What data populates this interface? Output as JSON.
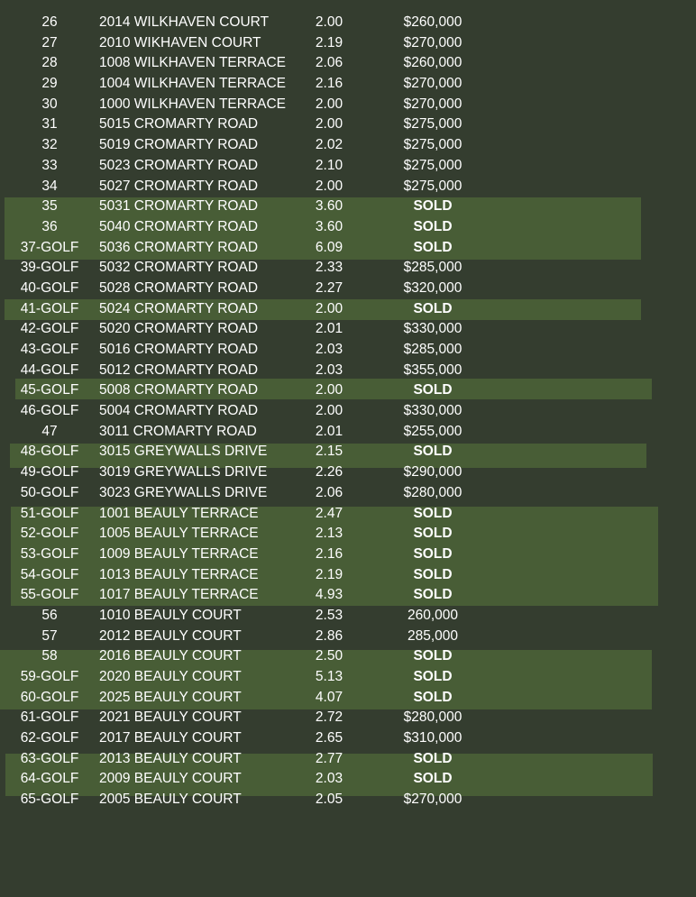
{
  "lots": [
    {
      "lot": "26",
      "address": "2014 WILKHAVEN COURT",
      "acres": "2.00",
      "price": "$260,000"
    },
    {
      "lot": "27",
      "address": "2010 WIKHAVEN COURT",
      "acres": "2.19",
      "price": "$270,000"
    },
    {
      "lot": "28",
      "address": "1008 WILKHAVEN TERRACE",
      "acres": "2.06",
      "price": "$260,000"
    },
    {
      "lot": "29",
      "address": "1004 WILKHAVEN TERRACE",
      "acres": "2.16",
      "price": "$270,000"
    },
    {
      "lot": "30",
      "address": "1000 WILKHAVEN TERRACE",
      "acres": "2.00",
      "price": "$270,000"
    },
    {
      "lot": "31",
      "address": "5015 CROMARTY ROAD",
      "acres": "2.00",
      "price": "$275,000"
    },
    {
      "lot": "32",
      "address": "5019 CROMARTY ROAD",
      "acres": "2.02",
      "price": "$275,000"
    },
    {
      "lot": "33",
      "address": "5023 CROMARTY ROAD",
      "acres": "2.10",
      "price": "$275,000"
    },
    {
      "lot": "34",
      "address": "5027 CROMARTY ROAD",
      "acres": "2.00",
      "price": "$275,000"
    },
    {
      "lot": "35",
      "address": "5031 CROMARTY ROAD",
      "acres": "3.60",
      "price": "SOLD"
    },
    {
      "lot": "36",
      "address": "5040 CROMARTY ROAD",
      "acres": "3.60",
      "price": "SOLD"
    },
    {
      "lot": "37-GOLF",
      "address": "5036 CROMARTY ROAD",
      "acres": "6.09",
      "price": "SOLD"
    },
    {
      "lot": "39-GOLF",
      "address": "5032 CROMARTY ROAD",
      "acres": "2.33",
      "price": "$285,000"
    },
    {
      "lot": "40-GOLF",
      "address": "5028 CROMARTY ROAD",
      "acres": "2.27",
      "price": "$320,000"
    },
    {
      "lot": "41-GOLF",
      "address": "5024 CROMARTY ROAD",
      "acres": "2.00",
      "price": "SOLD"
    },
    {
      "lot": "42-GOLF",
      "address": "5020 CROMARTY ROAD",
      "acres": "2.01",
      "price": "$330,000"
    },
    {
      "lot": "43-GOLF",
      "address": "5016 CROMARTY ROAD",
      "acres": "2.03",
      "price": "$285,000"
    },
    {
      "lot": "44-GOLF",
      "address": "5012 CROMARTY ROAD",
      "acres": "2.03",
      "price": "$355,000"
    },
    {
      "lot": "45-GOLF",
      "address": "5008 CROMARTY ROAD",
      "acres": "2.00",
      "price": "SOLD"
    },
    {
      "lot": "46-GOLF",
      "address": "5004 CROMARTY ROAD",
      "acres": "2.00",
      "price": "$330,000"
    },
    {
      "lot": "47",
      "address": "3011 CROMARTY ROAD",
      "acres": "2.01",
      "price": "$255,000"
    },
    {
      "lot": "48-GOLF",
      "address": "3015 GREYWALLS DRIVE",
      "acres": "2.15",
      "price": "SOLD"
    },
    {
      "lot": "49-GOLF",
      "address": "3019 GREYWALLS DRIVE",
      "acres": "2.26",
      "price": "$290,000"
    },
    {
      "lot": "50-GOLF",
      "address": "3023 GREYWALLS DRIVE",
      "acres": "2.06",
      "price": "$280,000"
    },
    {
      "lot": "51-GOLF",
      "address": "1001 BEAULY TERRACE",
      "acres": "2.47",
      "price": "SOLD"
    },
    {
      "lot": "52-GOLF",
      "address": "1005 BEAULY TERRACE",
      "acres": "2.13",
      "price": "SOLD"
    },
    {
      "lot": "53-GOLF",
      "address": "1009 BEAULY TERRACE",
      "acres": "2.16",
      "price": "SOLD"
    },
    {
      "lot": "54-GOLF",
      "address": "1013 BEAULY TERRACE",
      "acres": "2.19",
      "price": "SOLD"
    },
    {
      "lot": "55-GOLF",
      "address": "1017 BEAULY TERRACE",
      "acres": "4.93",
      "price": "SOLD"
    },
    {
      "lot": "56",
      "address": "1010 BEAULY COURT",
      "acres": "2.53",
      "price": "260,000"
    },
    {
      "lot": "57",
      "address": "2012 BEAULY COURT",
      "acres": "2.86",
      "price": "285,000"
    },
    {
      "lot": "58",
      "address": "2016 BEAULY COURT",
      "acres": "2.50",
      "price": "SOLD"
    },
    {
      "lot": "59-GOLF",
      "address": "2020 BEAULY COURT",
      "acres": "5.13",
      "price": "SOLD"
    },
    {
      "lot": "60-GOLF",
      "address": "2025 BEAULY COURT",
      "acres": "4.07",
      "price": "SOLD"
    },
    {
      "lot": "61-GOLF",
      "address": "2021 BEAULY COURT",
      "acres": "2.72",
      "price": "$280,000"
    },
    {
      "lot": "62-GOLF",
      "address": "2017 BEAULY COURT",
      "acres": "2.65",
      "price": "$310,000"
    },
    {
      "lot": "63-GOLF",
      "address": "2013 BEAULY COURT",
      "acres": "2.77",
      "price": "SOLD"
    },
    {
      "lot": "64-GOLF",
      "address": "2009 BEAULY COURT",
      "acres": "2.03",
      "price": "SOLD"
    },
    {
      "lot": "65-GOLF",
      "address": "2005 BEAULY COURT",
      "acres": "2.05",
      "price": "$270,000"
    }
  ],
  "colors": {
    "background": "#343d2f",
    "sold_highlight": "#485d36",
    "text": "#ffffff"
  }
}
